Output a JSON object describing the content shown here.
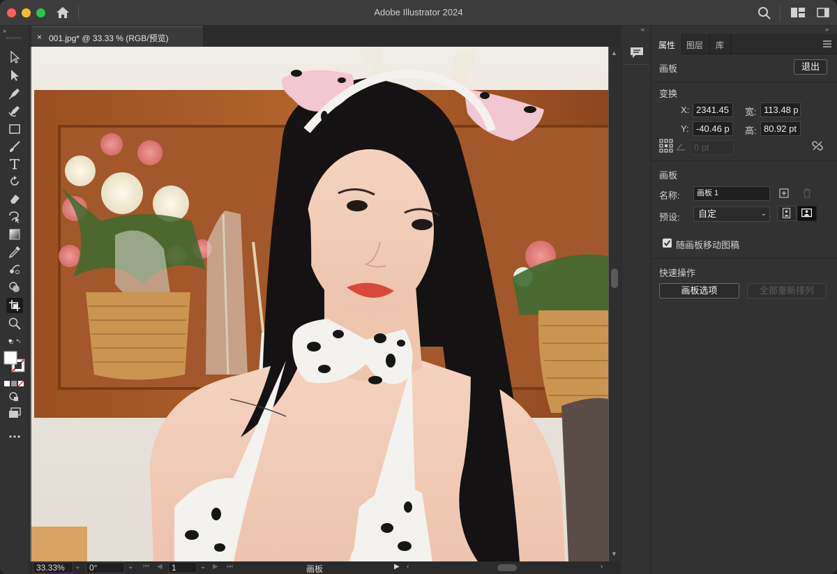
{
  "window": {
    "title": "Adobe Illustrator 2024"
  },
  "titlebar_icons": [
    "home-icon",
    "search-icon",
    "workspace-layout-icon",
    "panel-toggle-icon"
  ],
  "document_tab": {
    "close": "×",
    "label": "001.jpg* @ 33.33 % (RGB/预览)"
  },
  "status_bar": {
    "zoom": "33.33%",
    "rotation": "0°",
    "artboard_number": "1",
    "artboard_label": "画板"
  },
  "panel": {
    "tabs": [
      "属性",
      "图层",
      "库"
    ],
    "section_artboard": "画板",
    "exit_button": "退出",
    "transform": {
      "heading": "变换",
      "x_label": "X:",
      "x_value": "2341.45",
      "y_label": "Y:",
      "y_value": "-40.46 p",
      "w_label": "宽:",
      "w_value": "113.48 p",
      "h_label": "高:",
      "h_value": "80.92 pt",
      "rotate_value": "0 pt"
    },
    "artboard_section": {
      "heading": "画板",
      "name_label": "名称:",
      "name_value": "画板 1",
      "preset_label": "预设:",
      "preset_value": "自定",
      "move_with_artboard": "随画板移动图稿"
    },
    "quick_actions": {
      "heading": "快速操作",
      "artboard_options": "画板选项",
      "rearrange_all": "全部重新排列"
    }
  },
  "colors": {
    "accent_close": "#ff5f57",
    "accent_min": "#febc2e",
    "accent_max": "#28c840",
    "panel_bg": "#323232"
  }
}
